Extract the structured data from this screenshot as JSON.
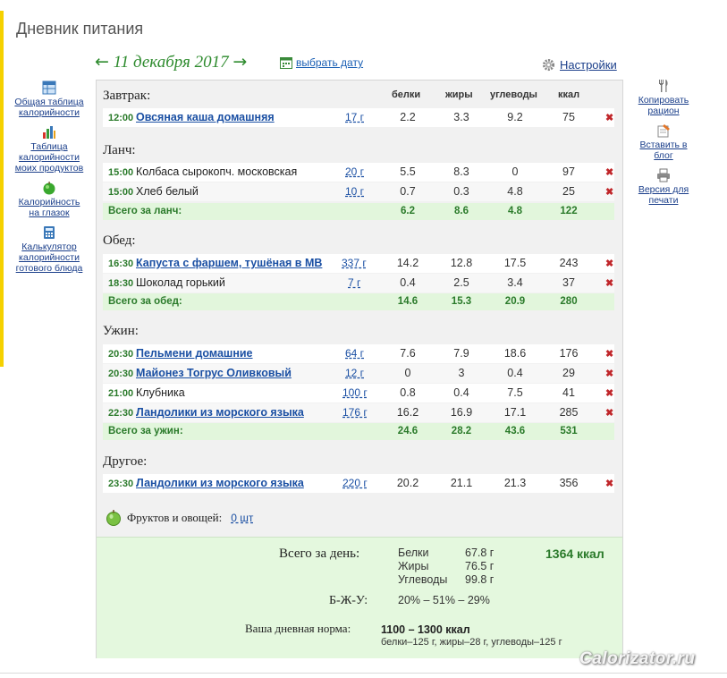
{
  "page_title": "Дневник питания",
  "date_nav": {
    "prev": "←",
    "date": "11 декабря 2017",
    "next": "→",
    "pick_date": "выбрать дату",
    "settings": "Настройки"
  },
  "left_nav": [
    {
      "label": "Общая таблица калорийности",
      "icon": "table-icon"
    },
    {
      "label": "Таблица калорийности моих продуктов",
      "icon": "bar-chart-icon"
    },
    {
      "label": "Калорийность на глазок",
      "icon": "apple-icon"
    },
    {
      "label": "Калькулятор калорийности готового блюда",
      "icon": "calculator-icon"
    }
  ],
  "right_nav": [
    {
      "label": "Копировать рацион",
      "icon": "cutlery-icon"
    },
    {
      "label": "Вставить в блог",
      "icon": "blog-icon"
    },
    {
      "label": "Версия для печати",
      "icon": "printer-icon"
    }
  ],
  "columns": {
    "protein": "белки",
    "fat": "жиры",
    "carbs": "углеводы",
    "kcal": "ккал"
  },
  "delete_icon": "✖",
  "meals": [
    {
      "title": "Завтрак:",
      "items": [
        {
          "time": "12:00",
          "name": "Овсяная каша домашняя",
          "link": true,
          "grams": "17 г",
          "protein": "2.2",
          "fat": "3.3",
          "carbs": "9.2",
          "kcal": "75"
        }
      ]
    },
    {
      "title": "Ланч:",
      "items": [
        {
          "time": "15:00",
          "name": "Колбаса сырокопч. московская",
          "link": false,
          "grams": "20 г",
          "protein": "5.5",
          "fat": "8.3",
          "carbs": "0",
          "kcal": "97"
        },
        {
          "time": "15:00",
          "name": "Хлеб белый",
          "link": false,
          "grams": "10 г",
          "protein": "0.7",
          "fat": "0.3",
          "carbs": "4.8",
          "kcal": "25"
        }
      ],
      "total": {
        "label": "Всего за ланч:",
        "protein": "6.2",
        "fat": "8.6",
        "carbs": "4.8",
        "kcal": "122"
      }
    },
    {
      "title": "Обед:",
      "items": [
        {
          "time": "16:30",
          "name": "Капуста с фаршем, тушёная в МВ",
          "link": true,
          "grams": "337 г",
          "protein": "14.2",
          "fat": "12.8",
          "carbs": "17.5",
          "kcal": "243"
        },
        {
          "time": "18:30",
          "name": "Шоколад горький",
          "link": false,
          "grams": "7 г",
          "protein": "0.4",
          "fat": "2.5",
          "carbs": "3.4",
          "kcal": "37"
        }
      ],
      "total": {
        "label": "Всего за обед:",
        "protein": "14.6",
        "fat": "15.3",
        "carbs": "20.9",
        "kcal": "280"
      }
    },
    {
      "title": "Ужин:",
      "items": [
        {
          "time": "20:30",
          "name": "Пельмени домашние",
          "link": true,
          "grams": "64 г",
          "protein": "7.6",
          "fat": "7.9",
          "carbs": "18.6",
          "kcal": "176"
        },
        {
          "time": "20:30",
          "name": "Майонез Тогрус Оливковый",
          "link": true,
          "grams": "12 г",
          "protein": "0",
          "fat": "3",
          "carbs": "0.4",
          "kcal": "29"
        },
        {
          "time": "21:00",
          "name": "Клубника",
          "link": false,
          "grams": "100 г",
          "protein": "0.8",
          "fat": "0.4",
          "carbs": "7.5",
          "kcal": "41"
        },
        {
          "time": "22:30",
          "name": "Ландолики из морского языка",
          "link": true,
          "grams": "176 г",
          "protein": "16.2",
          "fat": "16.9",
          "carbs": "17.1",
          "kcal": "285"
        }
      ],
      "total": {
        "label": "Всего за ужин:",
        "protein": "24.6",
        "fat": "28.2",
        "carbs": "43.6",
        "kcal": "531"
      }
    },
    {
      "title": "Другое:",
      "items": [
        {
          "time": "23:30",
          "name": "Ландолики из морского языка",
          "link": true,
          "grams": "220 г",
          "protein": "20.2",
          "fat": "21.1",
          "carbs": "21.3",
          "kcal": "356"
        }
      ]
    }
  ],
  "fruits": {
    "label": "Фруктов и овощей:",
    "value": "0 шт"
  },
  "summary": {
    "day_label": "Всего за день:",
    "protein_label": "Белки",
    "protein": "67.8 г",
    "fat_label": "Жиры",
    "fat": "76.5 г",
    "carbs_label": "Углеводы",
    "carbs": "99.8 г",
    "kcal": "1364 ккал",
    "ratio_label": "Б-Ж-У:",
    "ratio": "20% – 51% – 29%",
    "norm_label": "Ваша дневная норма:",
    "norm": "1100 – 1300 ккал",
    "norm_detail": "белки–125 г, жиры–28 г, углеводы–125 г"
  },
  "watermark": "Calorizator.ru"
}
